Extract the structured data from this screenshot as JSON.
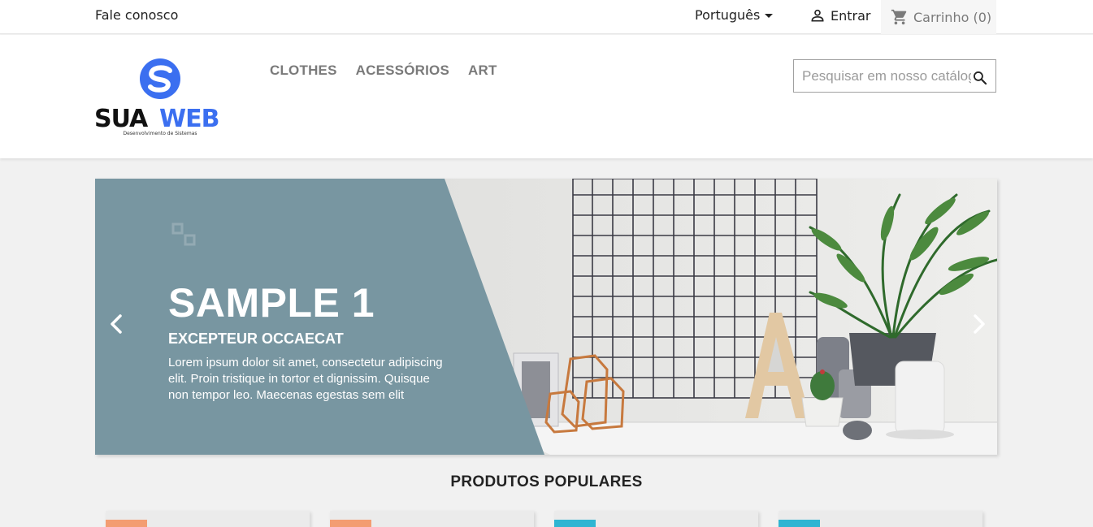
{
  "topnav": {
    "contact": "Fale conosco",
    "language": "Português",
    "signin": "Entrar",
    "cart": "Carrinho (0)"
  },
  "header": {
    "menu": [
      "CLOTHES",
      "ACESSÓRIOS",
      "ART"
    ],
    "search_placeholder": "Pesquisar em nosso catálogo"
  },
  "logo": {
    "text_dark": "SUA",
    "text_accent": "WEB",
    "tagline": "Desenvolvimento de Sistemas"
  },
  "slide": {
    "title": "SAMPLE 1",
    "subtitle": "EXCEPTEUR OCCAECAT",
    "text": "Lorem ipsum dolor sit amet, consectetur adipiscing elit. Proin tristique in tortor et dignissim. Quisque non tempor leo. Maecenas egestas sem elit"
  },
  "section": {
    "title": "PRODUTOS POPULARES"
  },
  "product_cards": [
    {
      "flag_color": "#f39d72"
    },
    {
      "flag_color": "#f39d72"
    },
    {
      "flag_color": "#2fb5d2"
    },
    {
      "flag_color": "#2fb5d2"
    }
  ],
  "colors": {
    "slide_panel": "#7896a1",
    "brand_blue": "#3b6ff0",
    "text_dark": "#232323",
    "muted": "#7a7a7a"
  }
}
